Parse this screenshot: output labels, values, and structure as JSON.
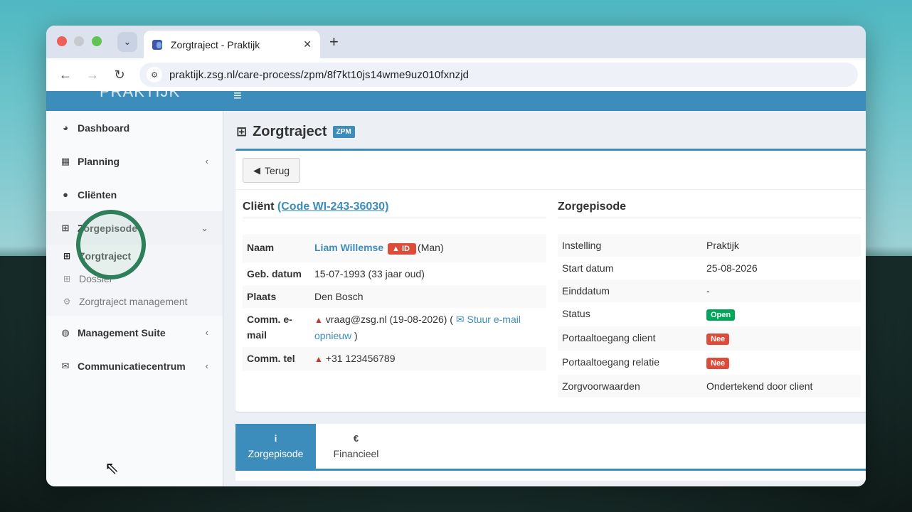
{
  "browser": {
    "tab_title": "Zorgtraject - Praktijk",
    "url": "praktijk.zsg.nl/care-process/zpm/8f7kt10js14wme9uz010fxnzjd"
  },
  "header": {
    "brand": "PRAKTIJK",
    "menu_icon": "≡"
  },
  "sidebar": {
    "items": [
      {
        "label": "Dashboard",
        "icon": "dashboard-icon"
      },
      {
        "label": "Planning",
        "icon": "calendar-icon"
      },
      {
        "label": "Cliënten",
        "icon": "user-icon"
      },
      {
        "label": "Zorgepisode",
        "icon": "medkit-icon"
      },
      {
        "label": "Management Suite",
        "icon": "globe-icon"
      },
      {
        "label": "Communicatiecentrum",
        "icon": "envelope-icon"
      }
    ],
    "submenu": [
      {
        "label": "Zorgtraject"
      },
      {
        "label": "Dossier"
      },
      {
        "label": "Zorgtraject management"
      }
    ]
  },
  "page": {
    "title": "Zorgtraject",
    "badge": "ZPM",
    "back_button": "Terug"
  },
  "client": {
    "heading": "Cliënt",
    "code_link": "(Code WI-243-36030)",
    "rows": {
      "naam_label": "Naam",
      "naam_value": "Liam Willemse",
      "naam_badge": "ID",
      "naam_gender": "(Man)",
      "geb_label": "Geb. datum",
      "geb_value": "15-07-1993 (33 jaar oud)",
      "plaats_label": "Plaats",
      "plaats_value": "Den Bosch",
      "email_label": "Comm. e-mail",
      "email_value": "vraag@zsg.nl (19-08-2026) (",
      "email_link": "Stuur e-mail opnieuw",
      "email_close": ")",
      "tel_label": "Comm. tel",
      "tel_value": "+31 123456789"
    }
  },
  "episode": {
    "heading": "Zorgepisode",
    "rows": [
      {
        "label": "Instelling",
        "value": "Praktijk"
      },
      {
        "label": "Start datum",
        "value": "25-08-2026"
      },
      {
        "label": "Einddatum",
        "value": "-"
      },
      {
        "label": "Status",
        "value": "Open"
      },
      {
        "label": "Portaaltoegang client",
        "value": "Nee"
      },
      {
        "label": "Portaaltoegang relatie",
        "value": "Nee"
      },
      {
        "label": "Zorgvoorwaarden",
        "value": "Ondertekend door client"
      }
    ]
  },
  "tabs": [
    {
      "label": "Zorgepisode",
      "icon": "info-icon",
      "glyph": "i"
    },
    {
      "label": "Financieel",
      "icon": "euro-icon",
      "glyph": "€"
    }
  ],
  "colors": {
    "primary": "#3c8dbc",
    "danger": "#dd4b39",
    "success": "#00a65a"
  }
}
